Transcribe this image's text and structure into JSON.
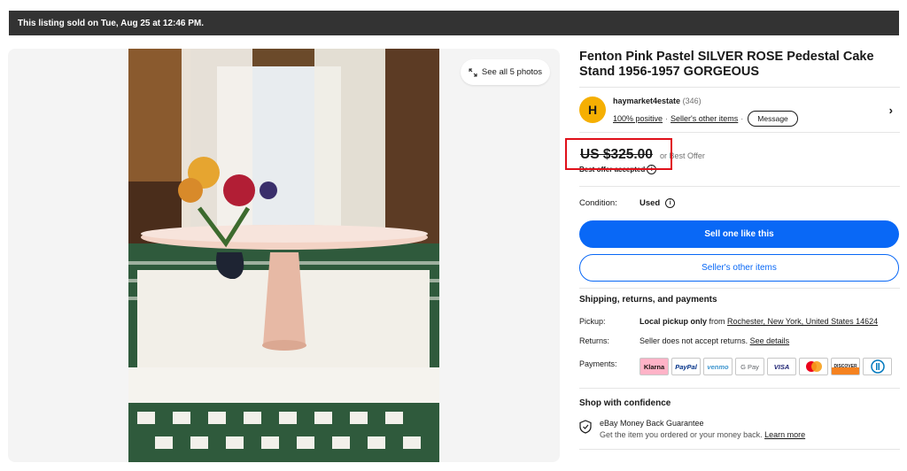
{
  "banner": {
    "text": "This listing sold on Tue, Aug 25 at 12:46 PM."
  },
  "gallery": {
    "see_all": "See all 5 photos",
    "icon": "expand-icon"
  },
  "listing": {
    "title": "Fenton Pink Pastel SILVER ROSE Pedestal Cake Stand 1956-1957 GORGEOUS"
  },
  "seller": {
    "avatar_letter": "H",
    "name": "haymarket4estate",
    "feedback_count": "(346)",
    "positive": "100% positive",
    "other_items": "Seller's other items",
    "message": "Message",
    "chevron": "›"
  },
  "price": {
    "amount": "US $325.00",
    "best_offer": "or Best Offer",
    "best_offer_accepted": "Best offer accepted"
  },
  "condition": {
    "label": "Condition:",
    "value": "Used"
  },
  "buttons": {
    "sell_one": "Sell one like this",
    "sellers_other": "Seller's other items"
  },
  "shipping": {
    "heading": "Shipping, returns, and payments",
    "pickup_label": "Pickup:",
    "pickup_bold": "Local pickup only",
    "pickup_from": " from ",
    "pickup_location": "Rochester, New York, United States 14624",
    "returns_label": "Returns:",
    "returns_text": "Seller does not accept returns. ",
    "returns_link": "See details",
    "payments_label": "Payments:",
    "methods": [
      "Klarna",
      "PayPal",
      "venmo",
      "G Pay",
      "VISA",
      "Mastercard",
      "DISCOVER",
      "Diners"
    ]
  },
  "confidence": {
    "heading": "Shop with confidence",
    "guarantee_title": "eBay Money Back Guarantee",
    "guarantee_text": "Get the item you ordered or your money back. ",
    "learn_more": "Learn more"
  },
  "colors": {
    "primary": "#0968f6",
    "banner": "#333333",
    "highlight_box": "#e0101a",
    "avatar": "#f5af02"
  }
}
